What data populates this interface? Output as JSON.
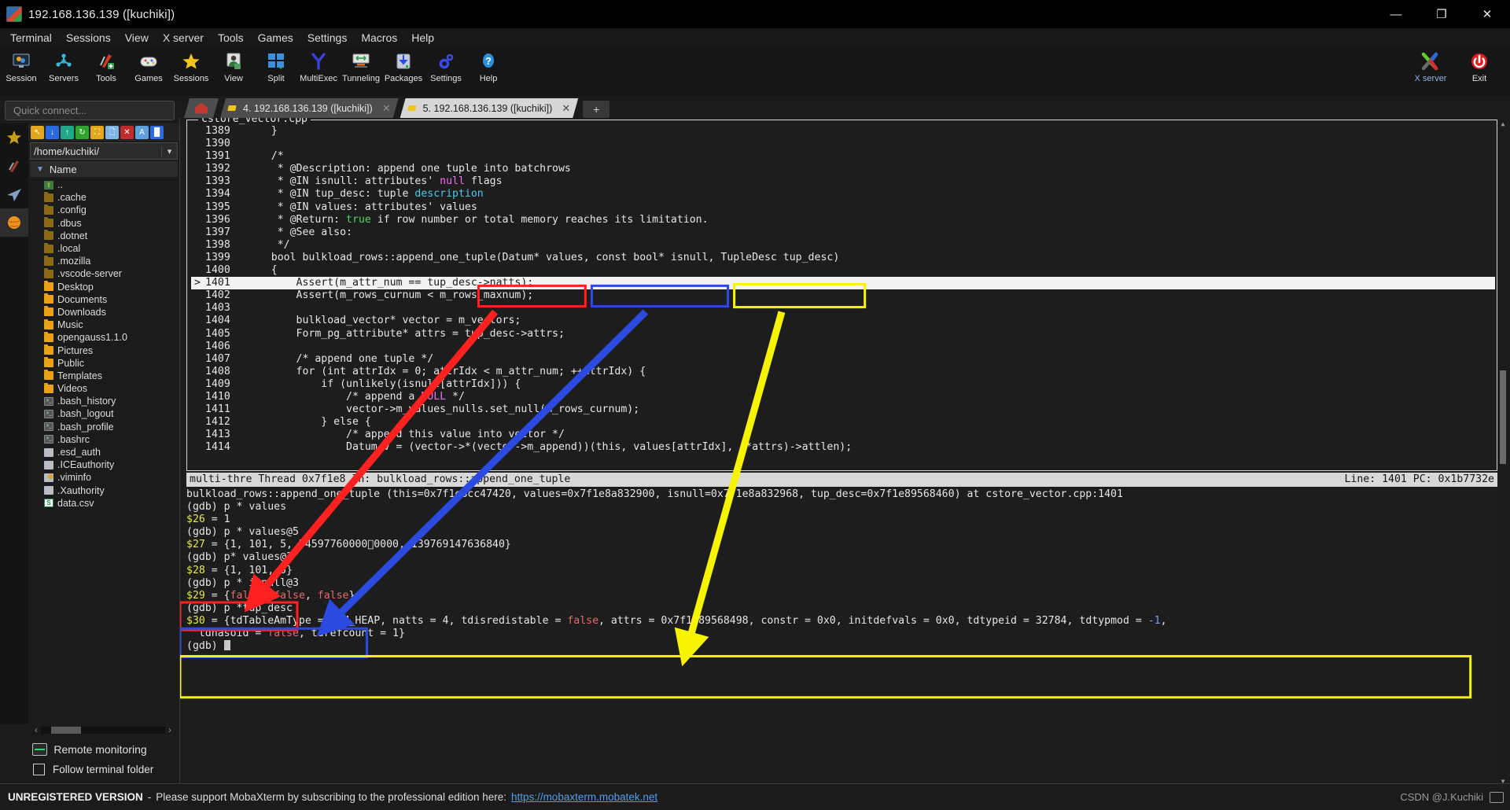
{
  "window": {
    "title": "192.168.136.139 ([kuchiki])",
    "icon": "mobaxterm-icon",
    "controls": {
      "minimize": "—",
      "maximize": "❐",
      "close": "✕"
    }
  },
  "menubar": [
    "Terminal",
    "Sessions",
    "View",
    "X server",
    "Tools",
    "Games",
    "Settings",
    "Macros",
    "Help"
  ],
  "ribbon": {
    "items": [
      {
        "label": "Session",
        "icon": "session-icon"
      },
      {
        "label": "Servers",
        "icon": "servers-icon"
      },
      {
        "label": "Tools",
        "icon": "tools-icon"
      },
      {
        "label": "Games",
        "icon": "games-icon"
      },
      {
        "label": "Sessions",
        "icon": "sessions-star-icon"
      },
      {
        "label": "View",
        "icon": "view-icon"
      },
      {
        "label": "Split",
        "icon": "split-icon"
      },
      {
        "label": "MultiExec",
        "icon": "multiexec-icon"
      },
      {
        "label": "Tunneling",
        "icon": "tunneling-icon"
      },
      {
        "label": "Packages",
        "icon": "packages-icon"
      },
      {
        "label": "Settings",
        "icon": "settings-gear-icon"
      },
      {
        "label": "Help",
        "icon": "help-icon"
      }
    ],
    "right": [
      {
        "label": "X server",
        "icon": "xserver-icon"
      },
      {
        "label": "Exit",
        "icon": "exit-power-icon"
      }
    ]
  },
  "sidebar": {
    "quick_connect_placeholder": "Quick connect...",
    "vtabs": [
      {
        "name": "favorites-tab",
        "icon": "star-icon",
        "selected": false
      },
      {
        "name": "tools-tab",
        "icon": "knife-icon",
        "selected": false
      },
      {
        "name": "sftp-tab",
        "icon": "plane-icon",
        "selected": false
      },
      {
        "name": "macros-tab",
        "icon": "globe-icon",
        "selected": true
      }
    ],
    "fb_tools": [
      "go-up-icon",
      "download-icon",
      "upload-icon",
      "refresh-icon",
      "new-folder-icon",
      "new-file-icon",
      "delete-icon",
      "text-mode-icon",
      "binary-mode-icon"
    ],
    "path": "/home/kuchiki/",
    "column_header": "Name",
    "files": [
      {
        "name": "..",
        "type": "up"
      },
      {
        "name": ".cache",
        "type": "folder-dim"
      },
      {
        "name": ".config",
        "type": "folder-dim"
      },
      {
        "name": ".dbus",
        "type": "folder-dim"
      },
      {
        "name": ".dotnet",
        "type": "folder-dim"
      },
      {
        "name": ".local",
        "type": "folder-dim"
      },
      {
        "name": ".mozilla",
        "type": "folder-dim"
      },
      {
        "name": ".vscode-server",
        "type": "folder-dim"
      },
      {
        "name": "Desktop",
        "type": "folder"
      },
      {
        "name": "Documents",
        "type": "folder"
      },
      {
        "name": "Downloads",
        "type": "folder"
      },
      {
        "name": "Music",
        "type": "folder"
      },
      {
        "name": "opengauss1.1.0",
        "type": "folder"
      },
      {
        "name": "Pictures",
        "type": "folder"
      },
      {
        "name": "Public",
        "type": "folder"
      },
      {
        "name": "Templates",
        "type": "folder"
      },
      {
        "name": "Videos",
        "type": "folder"
      },
      {
        "name": ".bash_history",
        "type": "shell"
      },
      {
        "name": ".bash_logout",
        "type": "shell"
      },
      {
        "name": ".bash_profile",
        "type": "shell"
      },
      {
        "name": ".bashrc",
        "type": "shell"
      },
      {
        "name": ".esd_auth",
        "type": "file"
      },
      {
        "name": ".ICEauthority",
        "type": "file"
      },
      {
        "name": ".viminfo",
        "type": "vim"
      },
      {
        "name": ".Xauthority",
        "type": "file"
      },
      {
        "name": "data.csv",
        "type": "csv"
      }
    ],
    "remote_monitoring": "Remote monitoring",
    "follow_terminal_folder": "Follow terminal folder",
    "follow_checked": false
  },
  "tabs": {
    "home_icon": "home-icon",
    "items": [
      {
        "label": "4. 192.168.136.139 ([kuchiki])",
        "active": false,
        "close": "✕"
      },
      {
        "label": "5. 192.168.136.139 ([kuchiki])",
        "active": true,
        "close": "✕"
      }
    ],
    "new_tab": "+"
  },
  "terminal": {
    "source_title": "cstore_vector.cpp",
    "code": [
      {
        "no": "1389",
        "mark": "",
        "cur": false,
        "parts": [
          {
            "t": "    }"
          }
        ]
      },
      {
        "no": "1390",
        "mark": "",
        "cur": false,
        "parts": [
          {
            "t": ""
          }
        ]
      },
      {
        "no": "1391",
        "mark": "",
        "cur": false,
        "parts": [
          {
            "t": "    /*"
          }
        ]
      },
      {
        "no": "1392",
        "mark": "",
        "cur": false,
        "parts": [
          {
            "t": "     * @Description: append one tuple into batchrows"
          }
        ]
      },
      {
        "no": "1393",
        "mark": "",
        "cur": false,
        "parts": [
          {
            "t": "     * @IN isnull: attributes' "
          },
          {
            "t": "null",
            "c": "k-mag"
          },
          {
            "t": " flags"
          }
        ]
      },
      {
        "no": "1394",
        "mark": "",
        "cur": false,
        "parts": [
          {
            "t": "     * @IN tup_desc: tuple "
          },
          {
            "t": "description",
            "c": "k-cyan"
          }
        ]
      },
      {
        "no": "1395",
        "mark": "",
        "cur": false,
        "parts": [
          {
            "t": "     * @IN values: attributes' values"
          }
        ]
      },
      {
        "no": "1396",
        "mark": "",
        "cur": false,
        "parts": [
          {
            "t": "     * @Return: "
          },
          {
            "t": "true",
            "c": "k-green"
          },
          {
            "t": " if row number or total memory reaches its limitation."
          }
        ]
      },
      {
        "no": "1397",
        "mark": "",
        "cur": false,
        "parts": [
          {
            "t": "     * @See also:"
          }
        ]
      },
      {
        "no": "1398",
        "mark": "",
        "cur": false,
        "parts": [
          {
            "t": "     */"
          }
        ]
      },
      {
        "no": "1399",
        "mark": "",
        "cur": false,
        "parts": [
          {
            "t": "    bool bulkload_rows::append_one_tuple(Datum* values, const bool* isnull, TupleDesc tup_desc)"
          }
        ]
      },
      {
        "no": "1400",
        "mark": "",
        "cur": false,
        "parts": [
          {
            "t": "    {"
          }
        ]
      },
      {
        "no": "1401",
        "mark": ">",
        "cur": true,
        "parts": [
          {
            "t": "        Assert(m_attr_num == tup_desc->natts);"
          }
        ]
      },
      {
        "no": "1402",
        "mark": "",
        "cur": false,
        "parts": [
          {
            "t": "        Assert(m_rows_curnum < m_rows_maxnum);"
          }
        ]
      },
      {
        "no": "1403",
        "mark": "",
        "cur": false,
        "parts": [
          {
            "t": ""
          }
        ]
      },
      {
        "no": "1404",
        "mark": "",
        "cur": false,
        "parts": [
          {
            "t": "        bulkload_vector* vector = m_vectors;"
          }
        ]
      },
      {
        "no": "1405",
        "mark": "",
        "cur": false,
        "parts": [
          {
            "t": "        Form_pg_attribute* attrs = tup_desc->attrs;"
          }
        ]
      },
      {
        "no": "1406",
        "mark": "",
        "cur": false,
        "parts": [
          {
            "t": ""
          }
        ]
      },
      {
        "no": "1407",
        "mark": "",
        "cur": false,
        "parts": [
          {
            "t": "        /* append one tuple */"
          }
        ]
      },
      {
        "no": "1408",
        "mark": "",
        "cur": false,
        "parts": [
          {
            "t": "        for (int attrIdx = 0; attrIdx < m_attr_num; ++attrIdx) {"
          }
        ]
      },
      {
        "no": "1409",
        "mark": "",
        "cur": false,
        "parts": [
          {
            "t": "            if (unlikely(isnull[attrIdx])) {"
          }
        ]
      },
      {
        "no": "1410",
        "mark": "",
        "cur": false,
        "parts": [
          {
            "t": "                /* append a "
          },
          {
            "t": "NULL",
            "c": "k-mag"
          },
          {
            "t": " */"
          }
        ]
      },
      {
        "no": "1411",
        "mark": "",
        "cur": false,
        "parts": [
          {
            "t": "                vector->m_values_nulls.set_null(m_rows_curnum);"
          }
        ]
      },
      {
        "no": "1412",
        "mark": "",
        "cur": false,
        "parts": [
          {
            "t": "            } else {"
          }
        ]
      },
      {
        "no": "1413",
        "mark": "",
        "cur": false,
        "parts": [
          {
            "t": "                /* append this value into vector */"
          }
        ]
      },
      {
        "no": "1414",
        "mark": "",
        "cur": false,
        "parts": [
          {
            "t": "                Datum v = (vector->*(vector->m_append))(this, values[attrIdx], (*attrs)->attlen);"
          }
        ]
      }
    ],
    "status_left": "multi-thre Thread 0x7f1e8 In: bulkload_rows::append_one_tuple",
    "status_right": "Line: 1401 PC: 0x1b7732e",
    "gdb": [
      {
        "parts": [
          {
            "t": "bulkload_rows::append_one_tuple (this=0x7f1e8cc47420, values=0x7f1e8a832900, isnull=0x7f1e8a832968, tup_desc=0x7f1e89568460) at cstore_vector.cpp:1401"
          }
        ]
      },
      {
        "parts": [
          {
            "t": "(gdb) p * values"
          }
        ]
      },
      {
        "parts": [
          {
            "t": "$26",
            "c": "k-yellow"
          },
          {
            "t": " = 1"
          }
        ]
      },
      {
        "parts": [
          {
            "t": "(gdb) p * values@5"
          }
        ]
      },
      {
        "parts": [
          {
            "t": "$27",
            "c": "k-yellow"
          },
          {
            "t": " = {1, 101, 5, 74597760000\u00000000, 139769147636840}"
          }
        ]
      },
      {
        "parts": [
          {
            "t": "(gdb) p* values@3"
          }
        ]
      },
      {
        "parts": [
          {
            "t": "$28",
            "c": "k-yellow"
          },
          {
            "t": " = {1, 101, 5}"
          }
        ]
      },
      {
        "parts": [
          {
            "t": "(gdb) p * isnull@3"
          }
        ]
      },
      {
        "parts": [
          {
            "t": "$29",
            "c": "k-yellow"
          },
          {
            "t": " = {"
          },
          {
            "t": "false",
            "c": "k-red"
          },
          {
            "t": ", "
          },
          {
            "t": "false",
            "c": "k-red"
          },
          {
            "t": ", "
          },
          {
            "t": "false",
            "c": "k-red"
          },
          {
            "t": "}"
          }
        ]
      },
      {
        "parts": [
          {
            "t": "(gdb) p *tup_desc"
          }
        ]
      },
      {
        "parts": [
          {
            "t": "$30",
            "c": "k-yellow"
          },
          {
            "t": " = {tdTableAmType = TAM_HEAP, natts = 4, tdisredistable = "
          },
          {
            "t": "false",
            "c": "k-red"
          },
          {
            "t": ", attrs = 0x7f1e89568498, constr = 0x0, initdefvals = 0x0, tdtypeid = 32784, tdtypmod = "
          },
          {
            "t": "-1",
            "c": "k-blue"
          },
          {
            "t": ","
          }
        ]
      },
      {
        "parts": [
          {
            "t": "  tdhasoid = "
          },
          {
            "t": "false",
            "c": "k-red"
          },
          {
            "t": ", tdrefcount = 1}"
          }
        ]
      },
      {
        "parts": [
          {
            "t": "(gdb) "
          },
          {
            "t": "█",
            "c": "caretcell"
          }
        ]
      }
    ]
  },
  "annotations": {
    "colors": {
      "red": "#ff2020",
      "blue": "#2b4be0",
      "yellow": "#f8f400"
    },
    "boxes": [
      {
        "name": "datum-values-param-box",
        "color": "red",
        "label": "Datum* values,"
      },
      {
        "name": "const-bool-isnull-box",
        "color": "blue",
        "label": "const bool* isnull,"
      },
      {
        "name": "tupledesc-tupdesc-box",
        "color": "yellow",
        "label": "TupleDesc tup_desc"
      },
      {
        "name": "values3-output-box",
        "color": "red",
        "label": "$28 = {1, 101, 5}"
      },
      {
        "name": "isnull3-output-box",
        "color": "blue",
        "label": "$29 = {false, false, false}"
      },
      {
        "name": "tupdesc-output-box",
        "color": "yellow",
        "label": "$30 = {tdTableAmType = TAM_HEAP, ...}"
      }
    ],
    "arrows": [
      {
        "name": "red-arrow",
        "color": "red",
        "from": "datum-values-param-box",
        "to": "values3-output-box"
      },
      {
        "name": "blue-arrow",
        "color": "blue",
        "from": "const-bool-isnull-box",
        "to": "isnull3-output-box"
      },
      {
        "name": "yellow-arrow",
        "color": "yellow",
        "from": "tupledesc-tupdesc-box",
        "to": "tupdesc-output-box"
      }
    ]
  },
  "statusbar": {
    "unregistered": "UNREGISTERED VERSION",
    "dash": "-",
    "message": "Please support MobaXterm by subscribing to the professional edition here:",
    "link": "https://mobaxterm.mobatek.net",
    "watermark": "CSDN @J.Kuchiki"
  }
}
